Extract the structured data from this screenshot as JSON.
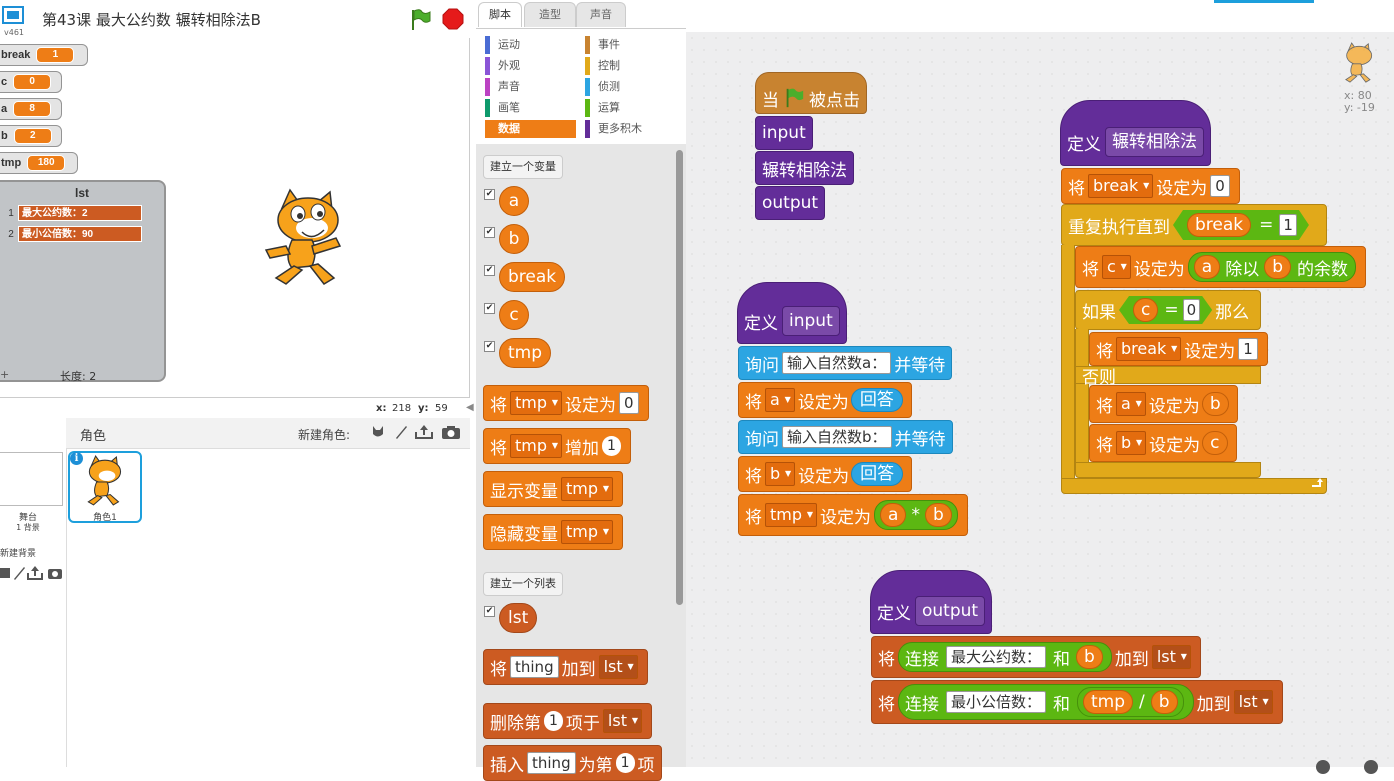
{
  "app": {
    "title": "第43课 最大公约数 辗转相除法B",
    "version": "v461"
  },
  "stage": {
    "monitors": [
      {
        "name": "break",
        "value": "1"
      },
      {
        "name": "c",
        "value": "0"
      },
      {
        "name": "a",
        "value": "8"
      },
      {
        "name": "b",
        "value": "2"
      },
      {
        "name": "tmp",
        "value": "180"
      }
    ],
    "list": {
      "name": "lst",
      "items": [
        {
          "index": "1",
          "value": "最大公约数：2"
        },
        {
          "index": "2",
          "value": "最小公倍数：90"
        }
      ],
      "add": "+",
      "length": "长度: 2"
    },
    "mouse_x_label": "x:",
    "mouse_x": "218",
    "mouse_y_label": "y:",
    "mouse_y": "59"
  },
  "sprite_pane": {
    "sprites_label": "角色",
    "new_sprite_label": "新建角色:",
    "stage_name": "舞台",
    "stage_backdrops": "1 背景",
    "new_backdrop_label": "新建背景",
    "sprite_name": "角色1",
    "info": "i"
  },
  "tabs": [
    {
      "label": "脚本",
      "active": true
    },
    {
      "label": "造型",
      "active": false
    },
    {
      "label": "声音",
      "active": false
    }
  ],
  "categories": [
    {
      "label": "运动",
      "color": "#4a6cd4"
    },
    {
      "label": "事件",
      "color": "#c88330"
    },
    {
      "label": "外观",
      "color": "#8a55d7"
    },
    {
      "label": "控制",
      "color": "#e1a91a"
    },
    {
      "label": "声音",
      "color": "#bb42c3"
    },
    {
      "label": "侦测",
      "color": "#2ca5e2"
    },
    {
      "label": "画笔",
      "color": "#0e9a6c"
    },
    {
      "label": "运算",
      "color": "#5cb712"
    },
    {
      "label": "数据",
      "color": "#ee7d16",
      "selected": true
    },
    {
      "label": "更多积木",
      "color": "#632d99"
    }
  ],
  "palette": {
    "make_variable": "建立一个变量",
    "variables": [
      "a",
      "b",
      "break",
      "c",
      "tmp"
    ],
    "checked": "✔",
    "set_block": {
      "verb": "将",
      "var": "tmp",
      "tail": "设定为",
      "value": "0"
    },
    "change_block": {
      "verb": "将",
      "var": "tmp",
      "tail": "增加",
      "value": "1"
    },
    "show_block": {
      "label": "显示变量",
      "var": "tmp"
    },
    "hide_block": {
      "label": "隐藏变量",
      "var": "tmp"
    },
    "make_list": "建立一个列表",
    "list_var": "lst",
    "add_block": {
      "verb": "将",
      "item": "thing",
      "tail": "加到",
      "list": "lst"
    },
    "delete_block": {
      "label": "删除第",
      "index": "1",
      "tail": "项于",
      "list": "lst"
    },
    "insert_block": {
      "label": "插入",
      "item": "thing",
      "mid": "为第",
      "index": "1",
      "tail": "项"
    }
  },
  "scripts": {
    "when_flag": {
      "prefix": "当",
      "suffix": "被点击"
    },
    "main_calls": [
      "input",
      "辗转相除法",
      "output"
    ],
    "def_input": {
      "define": "定义",
      "name": "input",
      "ask1": {
        "verb": "询问",
        "prompt": "输入自然数a：",
        "tail": "并等待"
      },
      "set_a": {
        "verb": "将",
        "var": "a",
        "tail": "设定为",
        "value": "回答"
      },
      "ask2": {
        "verb": "询问",
        "prompt": "输入自然数b：",
        "tail": "并等待"
      },
      "set_b": {
        "verb": "将",
        "var": "b",
        "tail": "设定为",
        "value": "回答"
      },
      "set_tmp": {
        "verb": "将",
        "var": "tmp",
        "tail": "设定为",
        "left": "a",
        "op": "*",
        "right": "b"
      }
    },
    "def_gcd": {
      "define": "定义",
      "name": "辗转相除法",
      "set_break": {
        "verb": "将",
        "var": "break",
        "tail": "设定为",
        "value": "0"
      },
      "repeat": {
        "label": "重复执行直到",
        "var": "break",
        "op": "=",
        "value": "1"
      },
      "set_c": {
        "verb": "将",
        "var": "c",
        "tail": "设定为",
        "left": "a",
        "op": "除以",
        "right": "b",
        "suffix": "的余数"
      },
      "if": {
        "label": "如果",
        "var": "c",
        "op": "=",
        "value": "0",
        "then": "那么"
      },
      "set_break1": {
        "verb": "将",
        "var": "break",
        "tail": "设定为",
        "value": "1"
      },
      "else": "否则",
      "set_a_b": {
        "verb": "将",
        "var": "a",
        "tail": "设定为",
        "value": "b"
      },
      "set_b_c": {
        "verb": "将",
        "var": "b",
        "tail": "设定为",
        "value": "c"
      }
    },
    "def_output": {
      "define": "定义",
      "name": "output",
      "add1": {
        "verb": "将",
        "join": "连接",
        "text": "最大公约数：",
        "and": "和",
        "value": "b",
        "tail": "加到",
        "list": "lst"
      },
      "add2": {
        "verb": "将",
        "join": "连接",
        "text": "最小公倍数：",
        "and": "和",
        "left": "tmp",
        "op": "/",
        "right": "b",
        "tail": "加到",
        "list": "lst"
      }
    },
    "sprite_x": "x: 80",
    "sprite_y": "y: -19"
  },
  "colors": {
    "data": "#ee7d16",
    "control": "#e1a91a",
    "sensing": "#2ca5e2",
    "more_blocks": "#632d99",
    "operators": "#5cb712",
    "events": "#c88330"
  }
}
